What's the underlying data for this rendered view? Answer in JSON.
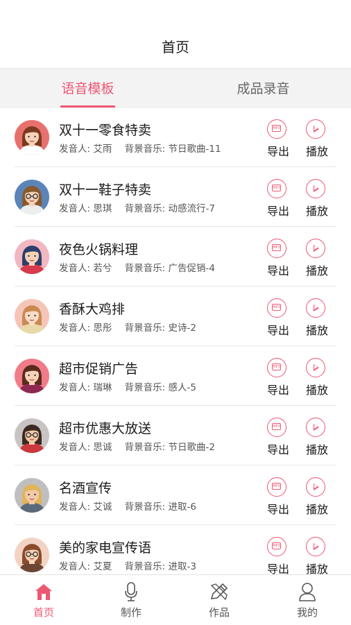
{
  "header": {
    "title": "首页"
  },
  "tabs": [
    {
      "label": "语音模板",
      "active": true
    },
    {
      "label": "成品录音",
      "active": false
    }
  ],
  "list_labels": {
    "speaker_prefix": "发音人:",
    "music_prefix": "背景音乐:",
    "export": "导出",
    "play": "播放",
    "mp3_badge": "MP3"
  },
  "templates": [
    {
      "title": "双十一零食特卖",
      "speaker": "艾雨",
      "music": "节日歌曲-11",
      "avatar": "female-red-bg-icon"
    },
    {
      "title": "双十一鞋子特卖",
      "speaker": "思琪",
      "music": "动感流行-7",
      "avatar": "female-glasses-blue-bg-icon"
    },
    {
      "title": "夜色火锅料理",
      "speaker": "若兮",
      "music": "广告促销-4",
      "avatar": "female-blue-hair-pink-bg-icon"
    },
    {
      "title": "香酥大鸡排",
      "speaker": "思彤",
      "music": "史诗-2",
      "avatar": "girl-pigtails-icon"
    },
    {
      "title": "超市促销广告",
      "speaker": "瑞琳",
      "music": "感人-5",
      "avatar": "female-pink-bg-icon"
    },
    {
      "title": "超市优惠大放送",
      "speaker": "思诚",
      "music": "节日歌曲-2",
      "avatar": "male-glasses-red-icon"
    },
    {
      "title": "名酒宣传",
      "speaker": "艾诚",
      "music": "进取-6",
      "avatar": "male-blond-grey-icon"
    },
    {
      "title": "美的家电宣传语",
      "speaker": "艾夏",
      "music": "进取-3",
      "avatar": "female-glasses-brown-icon"
    }
  ],
  "bottom_nav": [
    {
      "label": "首页",
      "icon": "home-icon",
      "active": true
    },
    {
      "label": "制作",
      "icon": "microphone-icon",
      "active": false
    },
    {
      "label": "作品",
      "icon": "works-icon",
      "active": false
    },
    {
      "label": "我的",
      "icon": "user-icon",
      "active": false
    }
  ],
  "colors": {
    "accent": "#ee5773",
    "text": "#1a1a1a",
    "muted": "#555555",
    "tab_bg": "#f3f3f4"
  }
}
